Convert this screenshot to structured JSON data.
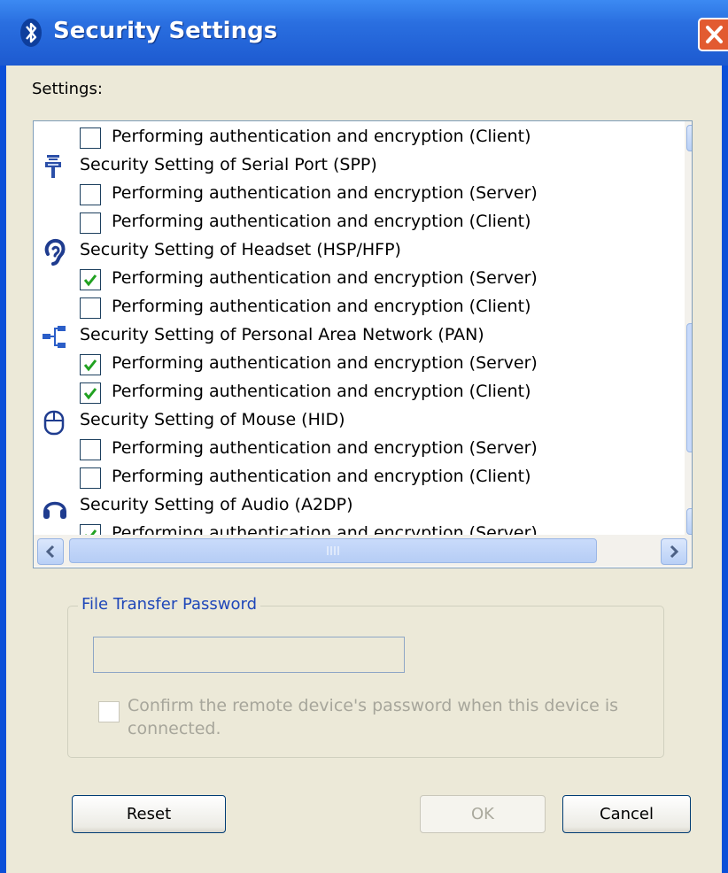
{
  "window": {
    "title": "Security Settings",
    "title_icon": "bluetooth-icon",
    "close_icon": "close-icon"
  },
  "settings_label": "Settings:",
  "list": {
    "rows": [
      {
        "type": "option",
        "label": "Performing authentication and encryption (Client)",
        "checked": false
      },
      {
        "type": "header",
        "icon": "serial-port-icon",
        "label": "Security Setting of Serial Port (SPP)"
      },
      {
        "type": "option",
        "label": "Performing authentication and encryption (Server)",
        "checked": false
      },
      {
        "type": "option",
        "label": "Performing authentication and encryption (Client)",
        "checked": false
      },
      {
        "type": "header",
        "icon": "headset-icon",
        "label": "Security Setting of Headset (HSP/HFP)"
      },
      {
        "type": "option",
        "label": "Performing authentication and encryption (Server)",
        "checked": true
      },
      {
        "type": "option",
        "label": "Performing authentication and encryption (Client)",
        "checked": false
      },
      {
        "type": "header",
        "icon": "network-icon",
        "label": "Security Setting of Personal Area Network (PAN)"
      },
      {
        "type": "option",
        "label": "Performing authentication and encryption (Server)",
        "checked": true
      },
      {
        "type": "option",
        "label": "Performing authentication and encryption (Client)",
        "checked": true
      },
      {
        "type": "header",
        "icon": "mouse-icon",
        "label": "Security Setting of Mouse (HID)"
      },
      {
        "type": "option",
        "label": "Performing authentication and encryption (Server)",
        "checked": false
      },
      {
        "type": "option",
        "label": "Performing authentication and encryption (Client)",
        "checked": false
      },
      {
        "type": "header",
        "icon": "audio-headphones-icon",
        "label": "Security Setting of Audio (A2DP)"
      },
      {
        "type": "option",
        "label": "Performing authentication and encryption (Server)",
        "checked": true
      }
    ]
  },
  "file_transfer": {
    "group_label": "File Transfer Password",
    "password_value": "",
    "confirm_label": "Confirm the remote device's password when this device is connected.",
    "confirm_checked": false
  },
  "buttons": {
    "reset": "Reset",
    "ok": "OK",
    "cancel": "Cancel"
  },
  "colors": {
    "titlebar": "#2a6fe0",
    "checkmark": "#21a121",
    "dialog_bg": "#ece9d8",
    "close": "#e25b31"
  }
}
